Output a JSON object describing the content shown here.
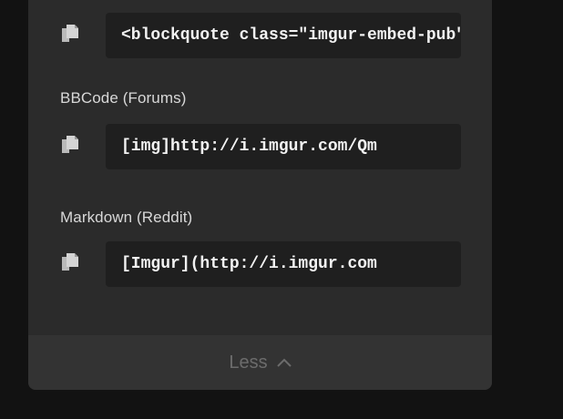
{
  "embed": {
    "html_code": "<blockquote class=\"imgur-embed-pub\" lang=\"en\" data-id=\"Qm\">",
    "bbcode_label": "BBCode (Forums)",
    "bbcode_code": "[img]http://i.imgur.com/Qm",
    "markdown_label": "Markdown (Reddit)",
    "markdown_code": "[Imgur](http://i.imgur.com"
  },
  "footer": {
    "toggle_label": "Less"
  },
  "icons": {
    "copy": "copy-icon",
    "toggle": "chevron-up-icon"
  },
  "colors": {
    "panel": "#2b2b2b",
    "code_box": "#1f1f1f",
    "footer": "#333333",
    "background": "#121212"
  }
}
